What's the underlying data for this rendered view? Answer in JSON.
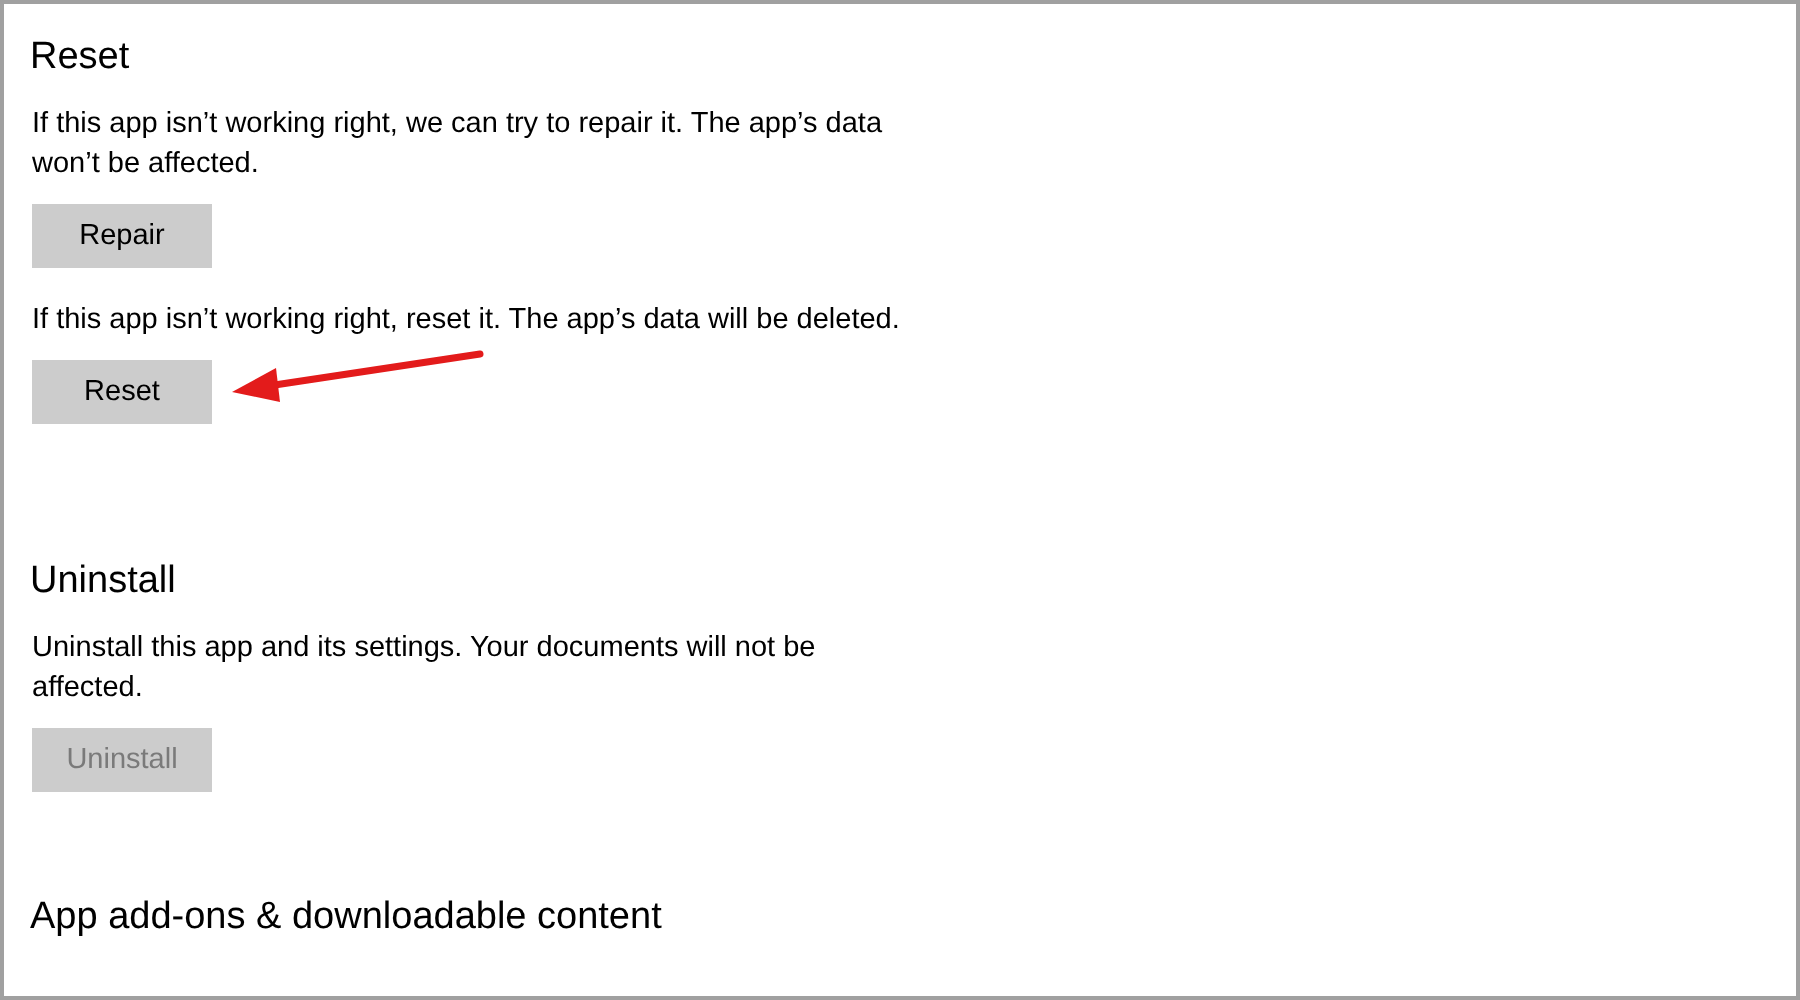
{
  "sections": [
    {
      "heading": "Reset",
      "items": [
        {
          "kind": "text",
          "text": "If this app isn’t working right, we can try to repair it. The app’s data won’t be affected."
        },
        {
          "kind": "button",
          "label": "Repair",
          "disabled": false,
          "highlighted": false
        },
        {
          "kind": "text",
          "text": "If this app isn’t working right, reset it. The app’s data will be deleted."
        },
        {
          "kind": "button",
          "label": "Reset",
          "disabled": false,
          "highlighted": true
        }
      ]
    },
    {
      "heading": "Uninstall",
      "items": [
        {
          "kind": "text",
          "text": "Uninstall this app and its settings. Your documents will not be affected."
        },
        {
          "kind": "button",
          "label": "Uninstall",
          "disabled": true,
          "highlighted": false
        }
      ]
    },
    {
      "heading": "App add-ons & downloadable content"
    }
  ]
}
